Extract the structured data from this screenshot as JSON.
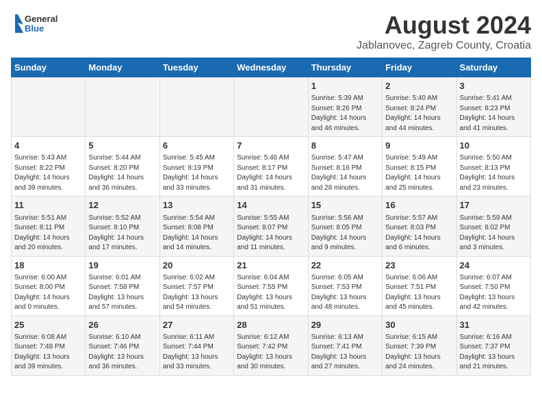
{
  "header": {
    "logo_general": "General",
    "logo_blue": "Blue",
    "title": "August 2024",
    "subtitle": "Jablanovec, Zagreb County, Croatia"
  },
  "days_of_week": [
    "Sunday",
    "Monday",
    "Tuesday",
    "Wednesday",
    "Thursday",
    "Friday",
    "Saturday"
  ],
  "weeks": [
    [
      {
        "day": "",
        "content": ""
      },
      {
        "day": "",
        "content": ""
      },
      {
        "day": "",
        "content": ""
      },
      {
        "day": "",
        "content": ""
      },
      {
        "day": "1",
        "content": "Sunrise: 5:39 AM\nSunset: 8:26 PM\nDaylight: 14 hours\nand 46 minutes."
      },
      {
        "day": "2",
        "content": "Sunrise: 5:40 AM\nSunset: 8:24 PM\nDaylight: 14 hours\nand 44 minutes."
      },
      {
        "day": "3",
        "content": "Sunrise: 5:41 AM\nSunset: 8:23 PM\nDaylight: 14 hours\nand 41 minutes."
      }
    ],
    [
      {
        "day": "4",
        "content": "Sunrise: 5:43 AM\nSunset: 8:22 PM\nDaylight: 14 hours\nand 39 minutes."
      },
      {
        "day": "5",
        "content": "Sunrise: 5:44 AM\nSunset: 8:20 PM\nDaylight: 14 hours\nand 36 minutes."
      },
      {
        "day": "6",
        "content": "Sunrise: 5:45 AM\nSunset: 8:19 PM\nDaylight: 14 hours\nand 33 minutes."
      },
      {
        "day": "7",
        "content": "Sunrise: 5:46 AM\nSunset: 8:17 PM\nDaylight: 14 hours\nand 31 minutes."
      },
      {
        "day": "8",
        "content": "Sunrise: 5:47 AM\nSunset: 8:16 PM\nDaylight: 14 hours\nand 28 minutes."
      },
      {
        "day": "9",
        "content": "Sunrise: 5:49 AM\nSunset: 8:15 PM\nDaylight: 14 hours\nand 25 minutes."
      },
      {
        "day": "10",
        "content": "Sunrise: 5:50 AM\nSunset: 8:13 PM\nDaylight: 14 hours\nand 23 minutes."
      }
    ],
    [
      {
        "day": "11",
        "content": "Sunrise: 5:51 AM\nSunset: 8:11 PM\nDaylight: 14 hours\nand 20 minutes."
      },
      {
        "day": "12",
        "content": "Sunrise: 5:52 AM\nSunset: 8:10 PM\nDaylight: 14 hours\nand 17 minutes."
      },
      {
        "day": "13",
        "content": "Sunrise: 5:54 AM\nSunset: 8:08 PM\nDaylight: 14 hours\nand 14 minutes."
      },
      {
        "day": "14",
        "content": "Sunrise: 5:55 AM\nSunset: 8:07 PM\nDaylight: 14 hours\nand 11 minutes."
      },
      {
        "day": "15",
        "content": "Sunrise: 5:56 AM\nSunset: 8:05 PM\nDaylight: 14 hours\nand 9 minutes."
      },
      {
        "day": "16",
        "content": "Sunrise: 5:57 AM\nSunset: 8:03 PM\nDaylight: 14 hours\nand 6 minutes."
      },
      {
        "day": "17",
        "content": "Sunrise: 5:59 AM\nSunset: 8:02 PM\nDaylight: 14 hours\nand 3 minutes."
      }
    ],
    [
      {
        "day": "18",
        "content": "Sunrise: 6:00 AM\nSunset: 8:00 PM\nDaylight: 14 hours\nand 0 minutes."
      },
      {
        "day": "19",
        "content": "Sunrise: 6:01 AM\nSunset: 7:58 PM\nDaylight: 13 hours\nand 57 minutes."
      },
      {
        "day": "20",
        "content": "Sunrise: 6:02 AM\nSunset: 7:57 PM\nDaylight: 13 hours\nand 54 minutes."
      },
      {
        "day": "21",
        "content": "Sunrise: 6:04 AM\nSunset: 7:55 PM\nDaylight: 13 hours\nand 51 minutes."
      },
      {
        "day": "22",
        "content": "Sunrise: 6:05 AM\nSunset: 7:53 PM\nDaylight: 13 hours\nand 48 minutes."
      },
      {
        "day": "23",
        "content": "Sunrise: 6:06 AM\nSunset: 7:51 PM\nDaylight: 13 hours\nand 45 minutes."
      },
      {
        "day": "24",
        "content": "Sunrise: 6:07 AM\nSunset: 7:50 PM\nDaylight: 13 hours\nand 42 minutes."
      }
    ],
    [
      {
        "day": "25",
        "content": "Sunrise: 6:08 AM\nSunset: 7:48 PM\nDaylight: 13 hours\nand 39 minutes."
      },
      {
        "day": "26",
        "content": "Sunrise: 6:10 AM\nSunset: 7:46 PM\nDaylight: 13 hours\nand 36 minutes."
      },
      {
        "day": "27",
        "content": "Sunrise: 6:11 AM\nSunset: 7:44 PM\nDaylight: 13 hours\nand 33 minutes."
      },
      {
        "day": "28",
        "content": "Sunrise: 6:12 AM\nSunset: 7:42 PM\nDaylight: 13 hours\nand 30 minutes."
      },
      {
        "day": "29",
        "content": "Sunrise: 6:13 AM\nSunset: 7:41 PM\nDaylight: 13 hours\nand 27 minutes."
      },
      {
        "day": "30",
        "content": "Sunrise: 6:15 AM\nSunset: 7:39 PM\nDaylight: 13 hours\nand 24 minutes."
      },
      {
        "day": "31",
        "content": "Sunrise: 6:16 AM\nSunset: 7:37 PM\nDaylight: 13 hours\nand 21 minutes."
      }
    ]
  ]
}
